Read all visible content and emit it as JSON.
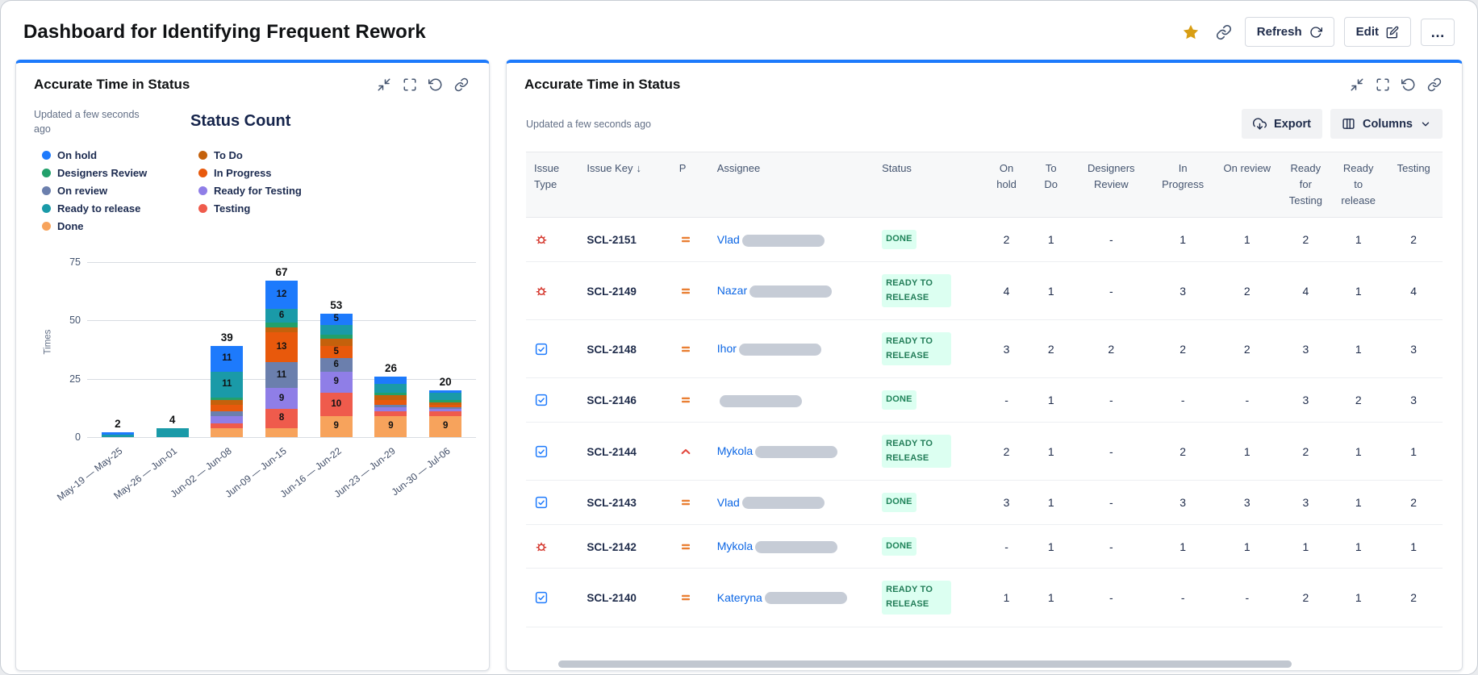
{
  "header": {
    "title": "Dashboard for Identifying Frequent Rework",
    "actions": {
      "refresh": "Refresh",
      "edit": "Edit",
      "more": "…"
    }
  },
  "left_panel": {
    "title": "Accurate Time in Status",
    "updated": "Updated a few seconds ago"
  },
  "right_panel": {
    "title": "Accurate Time in Status",
    "updated": "Updated a few seconds ago",
    "export_label": "Export",
    "columns_label": "Columns",
    "table": {
      "columns": [
        "Issue Type",
        "Issue Key",
        "P",
        "Assignee",
        "Status",
        "On hold",
        "To Do",
        "Designers Review",
        "In Progress",
        "On review",
        "Ready for Testing",
        "Ready to release",
        "Testing"
      ],
      "sort_column": "Issue Key",
      "sort_direction": "desc",
      "rows": [
        {
          "issue_type": "bug",
          "issue_key": "SCL-2151",
          "priority": "medium",
          "assignee_name": "Vlad",
          "assignee_redacted": true,
          "status": "DONE",
          "values": [
            "2",
            "1",
            "-",
            "1",
            "1",
            "2",
            "1",
            "2"
          ]
        },
        {
          "issue_type": "bug",
          "issue_key": "SCL-2149",
          "priority": "medium",
          "assignee_name": "Nazar",
          "assignee_redacted": true,
          "status": "READY TO RELEASE",
          "values": [
            "4",
            "1",
            "-",
            "3",
            "2",
            "4",
            "1",
            "4"
          ]
        },
        {
          "issue_type": "task",
          "issue_key": "SCL-2148",
          "priority": "medium",
          "assignee_name": "Ihor",
          "assignee_redacted": true,
          "status": "READY TO RELEASE",
          "values": [
            "3",
            "2",
            "2",
            "2",
            "2",
            "3",
            "1",
            "3"
          ]
        },
        {
          "issue_type": "task",
          "issue_key": "SCL-2146",
          "priority": "medium",
          "assignee_name": "",
          "assignee_redacted": true,
          "status": "DONE",
          "values": [
            "-",
            "1",
            "-",
            "-",
            "-",
            "3",
            "2",
            "3"
          ]
        },
        {
          "issue_type": "task",
          "issue_key": "SCL-2144",
          "priority": "high",
          "assignee_name": "Mykola",
          "assignee_redacted": true,
          "status": "READY TO RELEASE",
          "values": [
            "2",
            "1",
            "-",
            "2",
            "1",
            "2",
            "1",
            "1"
          ]
        },
        {
          "issue_type": "task",
          "issue_key": "SCL-2143",
          "priority": "medium",
          "assignee_name": "Vlad",
          "assignee_redacted": true,
          "status": "DONE",
          "values": [
            "3",
            "1",
            "-",
            "3",
            "3",
            "3",
            "1",
            "2"
          ]
        },
        {
          "issue_type": "bug",
          "issue_key": "SCL-2142",
          "priority": "medium",
          "assignee_name": "Mykola",
          "assignee_redacted": true,
          "status": "DONE",
          "values": [
            "-",
            "1",
            "-",
            "1",
            "1",
            "1",
            "1",
            "1"
          ]
        },
        {
          "issue_type": "task",
          "issue_key": "SCL-2140",
          "priority": "medium",
          "assignee_name": "Kateryna",
          "assignee_redacted": true,
          "status": "READY TO RELEASE",
          "values": [
            "1",
            "1",
            "-",
            "-",
            "-",
            "2",
            "1",
            "2"
          ]
        }
      ]
    }
  },
  "chart_data": {
    "type": "bar",
    "stacked": true,
    "title": "Status Count",
    "ylabel": "Times",
    "ylim": [
      0,
      80
    ],
    "yticks": [
      0,
      25,
      50,
      75
    ],
    "grid": true,
    "legend_position": "top-left",
    "legend_columns": [
      [
        "On hold",
        "Designers Review",
        "On review",
        "Ready to release",
        "Done"
      ],
      [
        "To Do",
        "In Progress",
        "Ready for Testing",
        "Testing"
      ]
    ],
    "categories": [
      "May-19 — May-25",
      "May-26 — Jun-01",
      "Jun-02 — Jun-08",
      "Jun-09 — Jun-15",
      "Jun-16 — Jun-22",
      "Jun-23 — Jun-29",
      "Jun-30 — Jul-06"
    ],
    "totals": [
      2,
      4,
      39,
      67,
      53,
      26,
      20
    ],
    "series": [
      {
        "name": "Done",
        "color": "#f7a35c",
        "values": [
          0,
          0,
          4,
          4,
          9,
          9,
          9
        ]
      },
      {
        "name": "Testing",
        "color": "#ef5b4c",
        "values": [
          0,
          0,
          2,
          8,
          10,
          2,
          2
        ]
      },
      {
        "name": "Ready for Testing",
        "color": "#8f7ee7",
        "values": [
          0,
          0,
          3,
          9,
          9,
          2,
          1
        ]
      },
      {
        "name": "On review",
        "color": "#6b7fad",
        "values": [
          0,
          0,
          2,
          11,
          6,
          1,
          1
        ]
      },
      {
        "name": "In Progress",
        "color": "#e8590c",
        "values": [
          0,
          0,
          3,
          13,
          5,
          2,
          1
        ]
      },
      {
        "name": "To Do",
        "color": "#c4610c",
        "values": [
          0,
          0,
          2,
          2,
          3,
          2,
          1
        ]
      },
      {
        "name": "Designers Review",
        "color": "#22a06b",
        "values": [
          0,
          0,
          1,
          2,
          2,
          1,
          1
        ]
      },
      {
        "name": "Ready to release",
        "color": "#1a9aa8",
        "values": [
          1,
          4,
          11,
          6,
          4,
          4,
          3
        ]
      },
      {
        "name": "On hold",
        "color": "#1d7afc",
        "values": [
          1,
          0,
          11,
          12,
          5,
          3,
          1
        ]
      }
    ]
  },
  "colors": {
    "accent": "#1d7afc",
    "star": "#d89e13",
    "link_text": "#0c66e4",
    "badge_bg": "#dcfff1",
    "badge_done_text": "#1f845a",
    "badge_ready_text": "#227d58",
    "bug_icon": "#d5392f",
    "task_icon": "#1d7afc",
    "priority_medium": "#e97f33",
    "priority_high": "#e2483d"
  }
}
